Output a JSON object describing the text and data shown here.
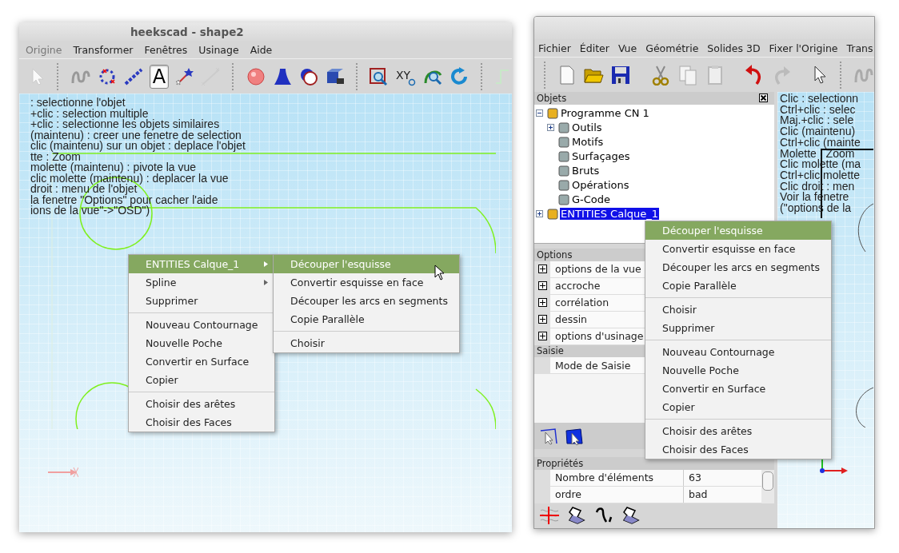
{
  "left_window": {
    "title": "heekscad - shape2",
    "menu": [
      "Origine",
      "Transformer",
      "Fenêtres",
      "Usinage",
      "Aide"
    ],
    "text_tool": {
      "label": "A",
      "pressed": true
    },
    "view_tool_label": "XY",
    "help_lines": [
      ": selectionne l'objet",
      "+clic : selection multiple",
      "+clic : selectionne les objets similaires",
      "(maintenu) : creer une fenetre de selection",
      "clic (maintenu) sur un objet : deplace l'objet",
      "tte : Zoom",
      "molette (maintenu) : pivote la vue",
      "clic molette (maintenu) : deplacer la vue",
      "droit : menu de l'objet",
      "la fenetre \"Options\" pour cacher l'aide",
      "ions de la vue\"->\"OSD\")"
    ],
    "context_menu": [
      [
        {
          "label": "ENTITIES Calque_1",
          "submenu": true,
          "selected": true
        },
        {
          "label": "Spline",
          "submenu": true,
          "selected": false
        },
        {
          "label": "Supprimer",
          "submenu": false,
          "selected": false
        }
      ],
      [
        {
          "label": "Nouveau Contournage",
          "submenu": false,
          "selected": false
        },
        {
          "label": "Nouvelle Poche",
          "submenu": false,
          "selected": false
        },
        {
          "label": "Convertir en Surface",
          "submenu": false,
          "selected": false
        },
        {
          "label": "Copier",
          "submenu": false,
          "selected": false
        }
      ],
      [
        {
          "label": "Choisir des arêtes",
          "submenu": false,
          "selected": false
        },
        {
          "label": "Choisir des Faces",
          "submenu": false,
          "selected": false
        }
      ]
    ],
    "submenu": [
      [
        {
          "label": "Découper l'esquisse",
          "selected": true
        },
        {
          "label": "Convertir esquisse en face",
          "selected": false
        },
        {
          "label": "Découper les arcs en segments",
          "selected": false
        },
        {
          "label": "Copie Parallèle",
          "selected": false
        }
      ],
      [
        {
          "label": "Choisir",
          "selected": false
        }
      ]
    ]
  },
  "right_window": {
    "menu": [
      "Fichier",
      "Éditer",
      "Vue",
      "Géométrie",
      "Solides 3D",
      "Fixer l'Origine",
      "Trans"
    ],
    "objects": {
      "title": "Objets",
      "tree": [
        {
          "label": "Programme CN 1",
          "expanded": true,
          "selected": false,
          "children": [
            {
              "label": "Outils",
              "expanded": false,
              "selected": false
            },
            {
              "label": "Motifs",
              "selected": false
            },
            {
              "label": "Surfaçages",
              "selected": false
            },
            {
              "label": "Bruts",
              "selected": false
            },
            {
              "label": "Opérations",
              "selected": false
            },
            {
              "label": "G-Code",
              "selected": false
            }
          ]
        },
        {
          "label": "ENTITIES Calque_1",
          "expanded": false,
          "selected": true
        }
      ]
    },
    "options": {
      "title": "Options",
      "rows": [
        {
          "label": "options de la vue",
          "expanded": false
        },
        {
          "label": "accroche",
          "expanded": false
        },
        {
          "label": "corrélation",
          "expanded": false
        },
        {
          "label": "dessin",
          "expanded": false
        },
        {
          "label": "options d'usinage",
          "expanded": false
        }
      ]
    },
    "input_mode": {
      "title": "Saisie",
      "rows": [
        "Mode de Saisie"
      ]
    },
    "properties": {
      "title": "Propriétés",
      "rows": [
        {
          "name": "Nombre d'éléments",
          "value": "63"
        },
        {
          "name": "ordre",
          "value": "bad"
        }
      ]
    },
    "help_lines": [
      "Clic : selectionn",
      "Ctrl+clic : selec",
      "Maj.+clic : sele",
      "Clic (maintenu)",
      "Ctrl+clic (mainte",
      "Molette : Zoom",
      "Clic molette (ma",
      "Ctrl+clic molette",
      "Clic droit : men",
      "Voir la fenetre",
      "(\"options de la"
    ],
    "context_menu": [
      [
        {
          "label": "Découper l'esquisse",
          "selected": true
        },
        {
          "label": "Convertir esquisse en face",
          "selected": false
        },
        {
          "label": "Découper les arcs en segments",
          "selected": false
        },
        {
          "label": "Copie Parallèle",
          "selected": false
        }
      ],
      [
        {
          "label": "Choisir",
          "selected": false
        },
        {
          "label": "Supprimer",
          "selected": false
        }
      ],
      [
        {
          "label": "Nouveau Contournage",
          "selected": false
        },
        {
          "label": "Nouvelle Poche",
          "selected": false
        },
        {
          "label": "Convertir en Surface",
          "selected": false
        },
        {
          "label": "Copier",
          "selected": false
        }
      ],
      [
        {
          "label": "Choisir des arêtes",
          "selected": false
        },
        {
          "label": "Choisir des Faces",
          "selected": false
        }
      ]
    ]
  }
}
